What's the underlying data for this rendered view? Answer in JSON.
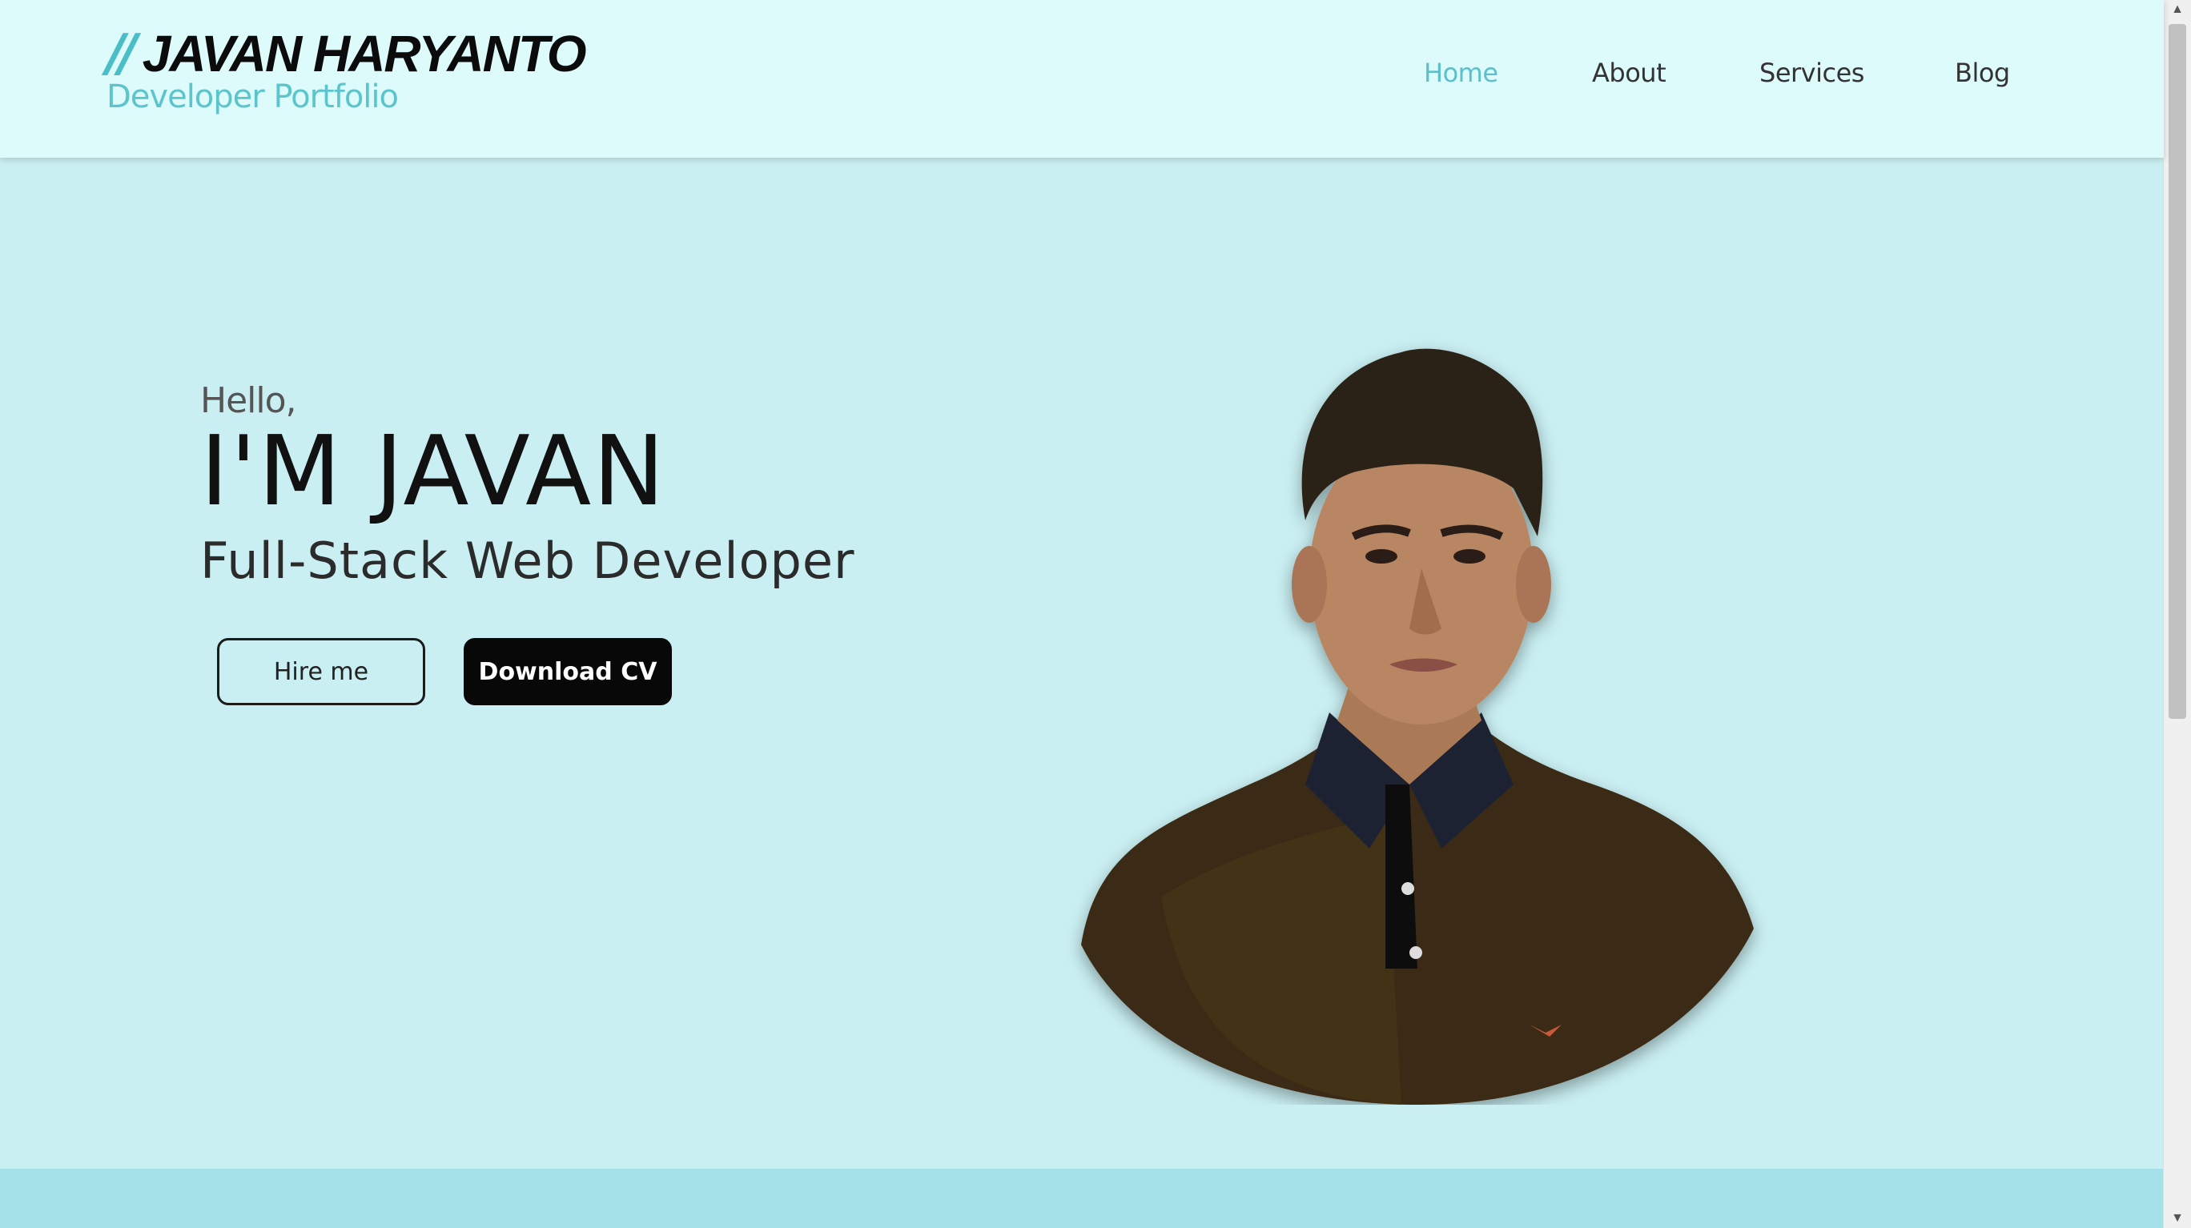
{
  "header": {
    "logo_slash": "//",
    "logo_name": "JAVAN HARYANTO",
    "logo_subtitle": "Developer Portfolio"
  },
  "nav": {
    "items": [
      {
        "label": "Home",
        "active": true
      },
      {
        "label": "About",
        "active": false
      },
      {
        "label": "Services",
        "active": false
      },
      {
        "label": "Blog",
        "active": false
      }
    ]
  },
  "hero": {
    "greeting": "Hello,",
    "headline": "I'M JAVAN",
    "subtitle": "Full-Stack Web Developer",
    "hire_label": "Hire me",
    "download_label": "Download CV"
  },
  "colors": {
    "accent": "#5cbfc9",
    "header_bg": "#defbfc",
    "hero_bg": "#c9eff2",
    "band_bg": "#a5e1e8"
  }
}
